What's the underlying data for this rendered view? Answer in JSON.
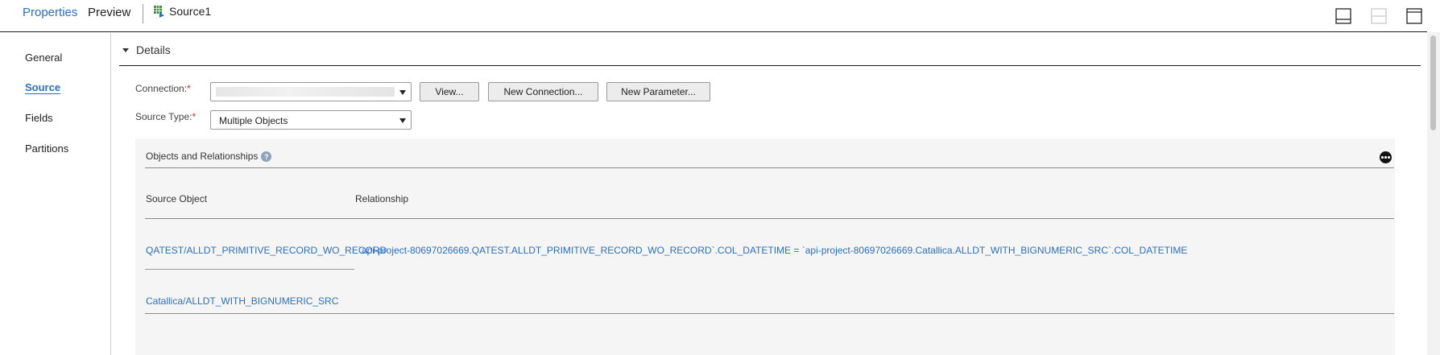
{
  "tabs": {
    "properties": "Properties",
    "preview": "Preview",
    "source": "Source1"
  },
  "nav": {
    "general": "General",
    "source": "Source",
    "fields": "Fields",
    "partitions": "Partitions"
  },
  "details": {
    "title": "Details",
    "connection_label": "Connection:",
    "source_type_label": "Source Type:",
    "required_mark": "*",
    "source_type_value": "Multiple Objects",
    "buttons": {
      "view": "View...",
      "new_connection": "New Connection...",
      "new_parameter": "New Parameter..."
    }
  },
  "objects": {
    "title": "Objects and Relationships",
    "help_glyph": "?",
    "columns": {
      "source_object": "Source Object",
      "relationship": "Relationship"
    },
    "rows": [
      {
        "source_object": "QATEST/ALLDT_PRIMITIVE_RECORD_WO_RECORD",
        "relationship": "`api-project-80697026669.QATEST.ALLDT_PRIMITIVE_RECORD_WO_RECORD`.COL_DATETIME = `api-project-80697026669.Catallica.ALLDT_WITH_BIGNUMERIC_SRC`.COL_DATETIME"
      },
      {
        "source_object": "Catallica/ALLDT_WITH_BIGNUMERIC_SRC",
        "relationship": ""
      }
    ]
  },
  "colors": {
    "accent": "#2b6fc2",
    "required": "#d4262c",
    "panel_bg": "#f5f5f5"
  },
  "icons": [
    "grid-table-icon",
    "dock-bottom-icon",
    "split-horizontal-icon",
    "maximize-icon",
    "caret-down-icon",
    "help-icon",
    "more-options-icon",
    "dropdown-arrow-icon"
  ]
}
